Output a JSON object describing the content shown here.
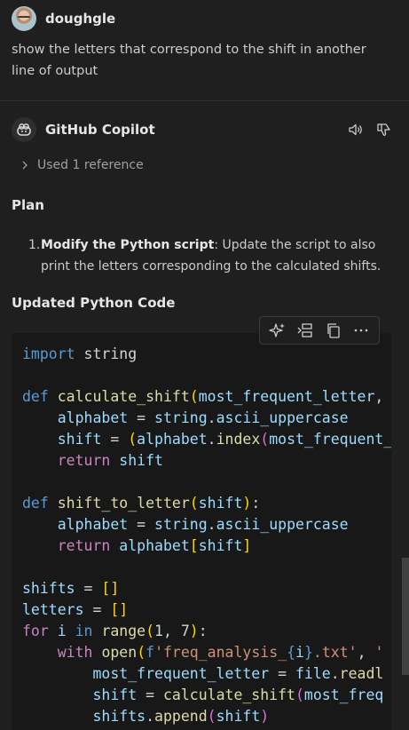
{
  "user": {
    "name": "doughgle",
    "message": "show the letters that correspond to the shift in another line of output"
  },
  "response": {
    "author": "GitHub Copilot",
    "reference_label": "Used 1 reference",
    "plan_heading": "Plan",
    "plan_items": [
      {
        "number": "1.",
        "bold": "Modify the Python script",
        "text": ": Update the script to also print the letters corresponding to the calculated shifts."
      }
    ],
    "code_heading": "Updated Python Code",
    "code_toolbar_icons": [
      "sparkle-icon",
      "insert-icon",
      "copy-icon",
      "more-icon"
    ],
    "header_icons": [
      "read-aloud-icon",
      "thumbs-down-icon"
    ]
  },
  "code_lines": [
    "import string",
    "",
    "def calculate_shift(most_frequent_letter,",
    "    alphabet = string.ascii_uppercase",
    "    shift = (alphabet.index(most_frequent_",
    "    return shift",
    "",
    "def shift_to_letter(shift):",
    "    alphabet = string.ascii_uppercase",
    "    return alphabet[shift]",
    "",
    "shifts = []",
    "letters = []",
    "for i in range(1, 7):",
    "    with open(f'freq_analysis_{i}.txt', '",
    "        most_frequent_letter = file.readl",
    "        shift = calculate_shift(most_freq",
    "        shifts.append(shift)"
  ],
  "colors": {
    "background": "#1f1f1f",
    "code_background": "#181818",
    "keyword": "#569cd6",
    "control_keyword": "#c586c0",
    "function": "#dcdcaa",
    "string": "#ce9178"
  }
}
